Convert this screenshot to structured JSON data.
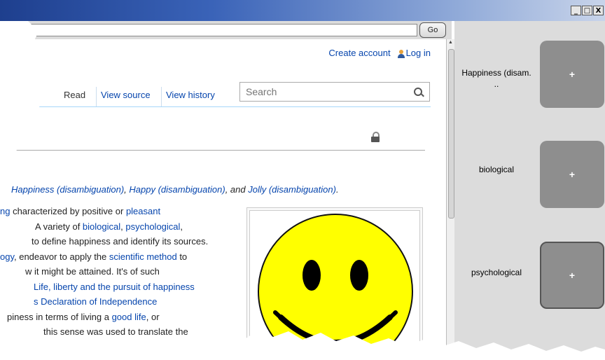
{
  "window": {
    "min_label": "_",
    "max_label": "□",
    "close_label": "X"
  },
  "addressbar": {
    "url": "",
    "go_label": "Go"
  },
  "personal": {
    "create_account": "Create account",
    "log_in": "Log in"
  },
  "tabs": [
    {
      "label": "Read"
    },
    {
      "label": "View source"
    },
    {
      "label": "View history"
    }
  ],
  "search": {
    "placeholder": "Search"
  },
  "hatnote": {
    "link1": "Happiness (disambiguation)",
    "sep1": ", ",
    "link2": "Happy (disambiguation)",
    "sep2": ", and ",
    "link3": "Jolly (disambiguation)",
    "end": "."
  },
  "article": {
    "l1_link1": "ng",
    "l1_text": " characterized by positive or ",
    "l1_link2": "pleasant",
    "l2_text1": "A variety of ",
    "l2_link1": "biological",
    "l2_sep": ", ",
    "l2_link2": "psychological",
    "l2_end": ",",
    "l3_text": " to define happiness and identify its sources.",
    "l4_link1": "ogy",
    "l4_text": ", endeavor to apply the ",
    "l4_link2": "scientific method",
    "l4_end": " to",
    "l5_text": "w it might be attained. It's of such",
    "l6_link": "Life, liberty and the pursuit of happiness",
    "l7_link": "s Declaration of Independence",
    "l8_text": "piness in terms of living a ",
    "l8_link": "good life",
    "l8_end": ", or",
    "l9_text": "this sense was used to translate the"
  },
  "sidebar": {
    "items": [
      {
        "label": "Happiness (disam.",
        "label2": "..",
        "button": "+"
      },
      {
        "label": "biological",
        "button": "+"
      },
      {
        "label": "psychological",
        "button": "+"
      }
    ]
  },
  "colors": {
    "link": "#0645ad",
    "sidebar_bg": "#dcdcdc",
    "button_bg": "#8e8e8e",
    "smiley": "#ffff00"
  }
}
